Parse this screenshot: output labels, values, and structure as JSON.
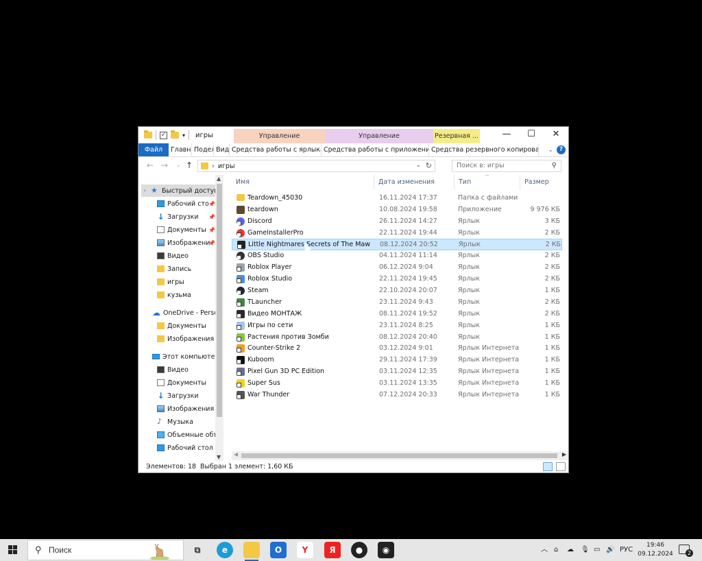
{
  "window": {
    "title": "игры",
    "context_tabs": [
      "Управление",
      "Управление",
      "Резервная ..."
    ],
    "ribbon_tabs": [
      "Файл",
      "Главна",
      "Подел",
      "Вид",
      "Средства работы с ярлыками",
      "Средства работы с приложениями",
      "Средства резервного копирования"
    ],
    "help": "?"
  },
  "address": {
    "path": "игры",
    "search_placeholder": "Поиск в: игры"
  },
  "nav": {
    "items": [
      {
        "label": "Быстрый доступ",
        "icon": "star-icon"
      },
      {
        "label": "Рабочий сто",
        "icon": "desktop-icon"
      },
      {
        "label": "Загрузки",
        "icon": "download-icon"
      },
      {
        "label": "Документы",
        "icon": "documents-icon"
      },
      {
        "label": "Изображени",
        "icon": "pictures-icon"
      },
      {
        "label": "Видео",
        "icon": "video-icon"
      },
      {
        "label": "Запись",
        "icon": "folder-icon"
      },
      {
        "label": "игры",
        "icon": "folder-icon"
      },
      {
        "label": "кузьма",
        "icon": "folder-icon"
      },
      {
        "label": "OneDrive - Persor",
        "icon": "onedrive-icon"
      },
      {
        "label": "Документы",
        "icon": "folder-icon"
      },
      {
        "label": "Изображения",
        "icon": "folder-icon"
      },
      {
        "label": "Этот компьютер",
        "icon": "computer-icon"
      },
      {
        "label": "Видео",
        "icon": "video-icon"
      },
      {
        "label": "Документы",
        "icon": "documents-icon"
      },
      {
        "label": "Загрузки",
        "icon": "download-icon"
      },
      {
        "label": "Изображения",
        "icon": "pictures-icon"
      },
      {
        "label": "Музыка",
        "icon": "music-icon"
      },
      {
        "label": "Объемные объ",
        "icon": "3d-objects-icon"
      },
      {
        "label": "Рабочий стол",
        "icon": "desktop-icon"
      }
    ]
  },
  "columns": [
    "Имя",
    "Дата изменения",
    "Тип",
    "Размер"
  ],
  "files": [
    {
      "name": "Teardown_45030",
      "date": "16.11.2024 17:37",
      "type": "Папка с файлами",
      "size": ""
    },
    {
      "name": "teardown",
      "date": "10.08.2024 19:58",
      "type": "Приложение",
      "size": "9 976 КБ"
    },
    {
      "name": "Discord",
      "date": "26.11.2024 14:27",
      "type": "Ярлык",
      "size": "3 КБ"
    },
    {
      "name": "GameInstallerPro",
      "date": "22.11.2024 19:44",
      "type": "Ярлык",
      "size": "2 КБ"
    },
    {
      "name": "Little Nightmares Secrets of The Maw Ch...",
      "date": "08.12.2024 20:52",
      "type": "Ярлык",
      "size": "2 КБ"
    },
    {
      "name": "OBS Studio",
      "date": "04.11.2024 11:14",
      "type": "Ярлык",
      "size": "2 КБ"
    },
    {
      "name": "Roblox Player",
      "date": "06.12.2024 9:04",
      "type": "Ярлык",
      "size": "2 КБ"
    },
    {
      "name": "Roblox Studio",
      "date": "22.11.2024 19:45",
      "type": "Ярлык",
      "size": "2 КБ"
    },
    {
      "name": "Steam",
      "date": "22.10.2024 20:07",
      "type": "Ярлык",
      "size": "1 КБ"
    },
    {
      "name": "TLauncher",
      "date": "23.11.2024 9:43",
      "type": "Ярлык",
      "size": "2 КБ"
    },
    {
      "name": "Видео МОНТАЖ",
      "date": "08.11.2024 19:52",
      "type": "Ярлык",
      "size": "2 КБ"
    },
    {
      "name": "Игры по сети",
      "date": "23.11.2024 8:25",
      "type": "Ярлык",
      "size": "1 КБ"
    },
    {
      "name": "Растения против Зомби",
      "date": "08.12.2024 20:40",
      "type": "Ярлык",
      "size": "1 КБ"
    },
    {
      "name": "Counter-Strike 2",
      "date": "03.12.2024 9:01",
      "type": "Ярлык Интернета",
      "size": "1 КБ"
    },
    {
      "name": "Kuboom",
      "date": "29.11.2024 17:39",
      "type": "Ярлык Интернета",
      "size": "1 КБ"
    },
    {
      "name": "Pixel Gun 3D PC Edition",
      "date": "03.11.2024 12:35",
      "type": "Ярлык Интернета",
      "size": "1 КБ"
    },
    {
      "name": "Super Sus",
      "date": "03.11.2024 13:35",
      "type": "Ярлык Интернета",
      "size": "1 КБ"
    },
    {
      "name": "War Thunder",
      "date": "07.12.2024 20:33",
      "type": "Ярлык Интернета",
      "size": "1 КБ"
    }
  ],
  "status": {
    "count": "Элементов: 18",
    "selected": "Выбран 1 элемент: 1,60 КБ"
  },
  "taskbar": {
    "search_label": "Поиск",
    "lang": "РУС",
    "time": "19:46",
    "date": "09.12.2024",
    "notifications": "2"
  },
  "colors": {
    "accent": "#1b6bc3",
    "selection": "#cce8ff",
    "ctx_shortcuts": "#f7d3c0",
    "ctx_apps": "#e8cdee",
    "ctx_backup": "#f5ec88"
  }
}
